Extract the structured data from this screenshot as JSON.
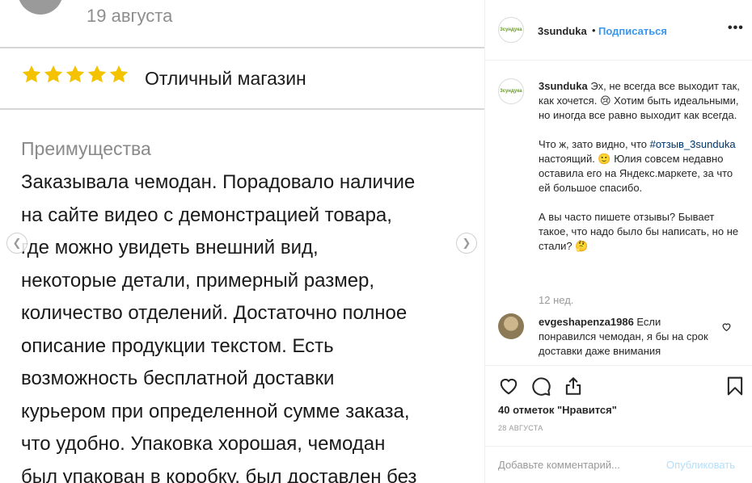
{
  "photo": {
    "date": "19 августа",
    "rating_stars": 5,
    "star_color": "#f4c300",
    "title": "Отличный магазин",
    "section_heading": "Преимущества",
    "body_lines": [
      "Заказывала чемодан. Порадовало наличие",
      "на сайте видео с демонстрацией товара,",
      "где можно увидеть внешний вид,",
      "некоторые детали, примерный размер,",
      "количество отделений.  Достаточно полное",
      "описание продукции текстом. Есть",
      "возможность бесплатной доставки",
      "курьером при определенной сумме заказа,",
      "что удобно. Упаковка хорошая, чемодан",
      "был упакован в коробку, был доставлен без"
    ],
    "prev_icon": "chevron-left-icon",
    "next_icon": "chevron-right-icon"
  },
  "post": {
    "logo_text": "3сундука",
    "username": "3sunduka",
    "separator": "•",
    "follow_label": "Подписаться",
    "more_label": "•••",
    "caption": {
      "username": "3sunduka",
      "p1": "Эх, не всегда все выходит так, как хочется. 😢 Хотим быть идеальными, но иногда все равно выходит как всегда.",
      "p2_before": "Что ж, зато видно, что ",
      "hashtag": "#отзыв_3sunduka",
      "p2_after": " настоящий. 🙂 Юлия совсем недавно оставила его на Яндекс.маркете, за что ей большое спасибо.",
      "p3": "А вы часто пишете отзывы? Бывает такое, что надо было бы написать, но не стали? 🤔",
      "time": "12 нед."
    },
    "comment": {
      "username": "evgeshapenza1986",
      "text": " Если понравился чемодан, я бы на срок доставки даже внимания"
    },
    "likes": "40 отметок \"Нравится\"",
    "date": "28 АВГУСТА",
    "add_comment_placeholder": "Добавьте комментарий...",
    "publish_label": "Опубликовать",
    "accent_color": "#3897f0",
    "icons": [
      "heart-icon",
      "comment-icon",
      "share-icon",
      "bookmark-icon"
    ]
  }
}
